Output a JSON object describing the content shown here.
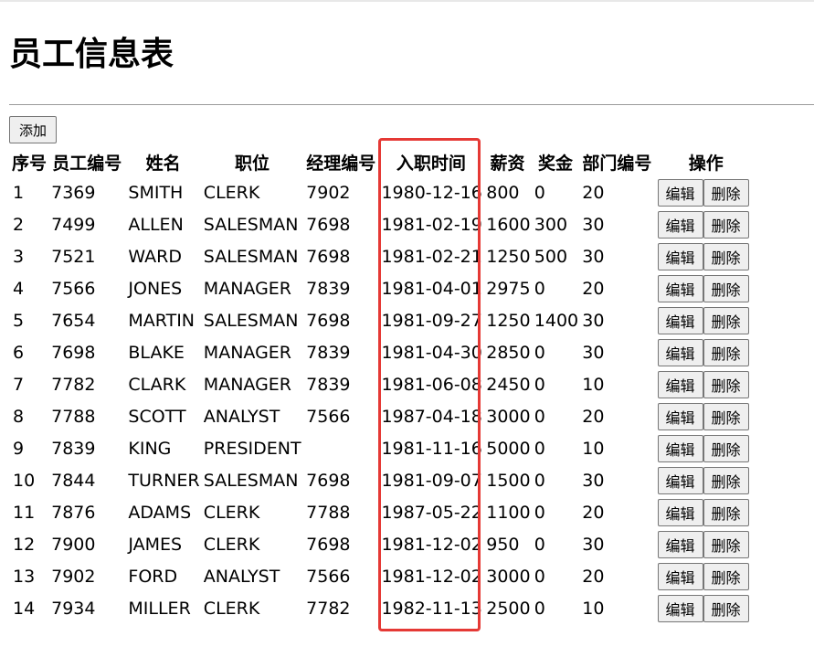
{
  "page": {
    "title": "员工信息表",
    "add_label": "添加"
  },
  "table": {
    "headers": [
      "序号",
      "员工编号",
      "姓名",
      "职位",
      "经理编号",
      "入职时间",
      "薪资",
      "奖金",
      "部门编号",
      "操作"
    ],
    "edit_label": "编辑",
    "delete_label": "删除",
    "rows": [
      {
        "idx": "1",
        "empno": "7369",
        "ename": "SMITH",
        "job": "CLERK",
        "mgr": "7902",
        "hiredate": "1980-12-16",
        "sal": "800",
        "comm": "0",
        "deptno": "20"
      },
      {
        "idx": "2",
        "empno": "7499",
        "ename": "ALLEN",
        "job": "SALESMAN",
        "mgr": "7698",
        "hiredate": "1981-02-19",
        "sal": "1600",
        "comm": "300",
        "deptno": "30"
      },
      {
        "idx": "3",
        "empno": "7521",
        "ename": "WARD",
        "job": "SALESMAN",
        "mgr": "7698",
        "hiredate": "1981-02-21",
        "sal": "1250",
        "comm": "500",
        "deptno": "30"
      },
      {
        "idx": "4",
        "empno": "7566",
        "ename": "JONES",
        "job": "MANAGER",
        "mgr": "7839",
        "hiredate": "1981-04-01",
        "sal": "2975",
        "comm": "0",
        "deptno": "20"
      },
      {
        "idx": "5",
        "empno": "7654",
        "ename": "MARTIN",
        "job": "SALESMAN",
        "mgr": "7698",
        "hiredate": "1981-09-27",
        "sal": "1250",
        "comm": "1400",
        "deptno": "30"
      },
      {
        "idx": "6",
        "empno": "7698",
        "ename": "BLAKE",
        "job": "MANAGER",
        "mgr": "7839",
        "hiredate": "1981-04-30",
        "sal": "2850",
        "comm": "0",
        "deptno": "30"
      },
      {
        "idx": "7",
        "empno": "7782",
        "ename": "CLARK",
        "job": "MANAGER",
        "mgr": "7839",
        "hiredate": "1981-06-08",
        "sal": "2450",
        "comm": "0",
        "deptno": "10"
      },
      {
        "idx": "8",
        "empno": "7788",
        "ename": "SCOTT",
        "job": "ANALYST",
        "mgr": "7566",
        "hiredate": "1987-04-18",
        "sal": "3000",
        "comm": "0",
        "deptno": "20"
      },
      {
        "idx": "9",
        "empno": "7839",
        "ename": "KING",
        "job": "PRESIDENT",
        "mgr": "",
        "hiredate": "1981-11-16",
        "sal": "5000",
        "comm": "0",
        "deptno": "10"
      },
      {
        "idx": "10",
        "empno": "7844",
        "ename": "TURNER",
        "job": "SALESMAN",
        "mgr": "7698",
        "hiredate": "1981-09-07",
        "sal": "1500",
        "comm": "0",
        "deptno": "30"
      },
      {
        "idx": "11",
        "empno": "7876",
        "ename": "ADAMS",
        "job": "CLERK",
        "mgr": "7788",
        "hiredate": "1987-05-22",
        "sal": "1100",
        "comm": "0",
        "deptno": "20"
      },
      {
        "idx": "12",
        "empno": "7900",
        "ename": "JAMES",
        "job": "CLERK",
        "mgr": "7698",
        "hiredate": "1981-12-02",
        "sal": "950",
        "comm": "0",
        "deptno": "30"
      },
      {
        "idx": "13",
        "empno": "7902",
        "ename": "FORD",
        "job": "ANALYST",
        "mgr": "7566",
        "hiredate": "1981-12-02",
        "sal": "3000",
        "comm": "0",
        "deptno": "20"
      },
      {
        "idx": "14",
        "empno": "7934",
        "ename": "MILLER",
        "job": "CLERK",
        "mgr": "7782",
        "hiredate": "1982-11-13",
        "sal": "2500",
        "comm": "0",
        "deptno": "10"
      }
    ]
  },
  "highlight": {
    "column": "入职时间",
    "color": "#e53935"
  }
}
